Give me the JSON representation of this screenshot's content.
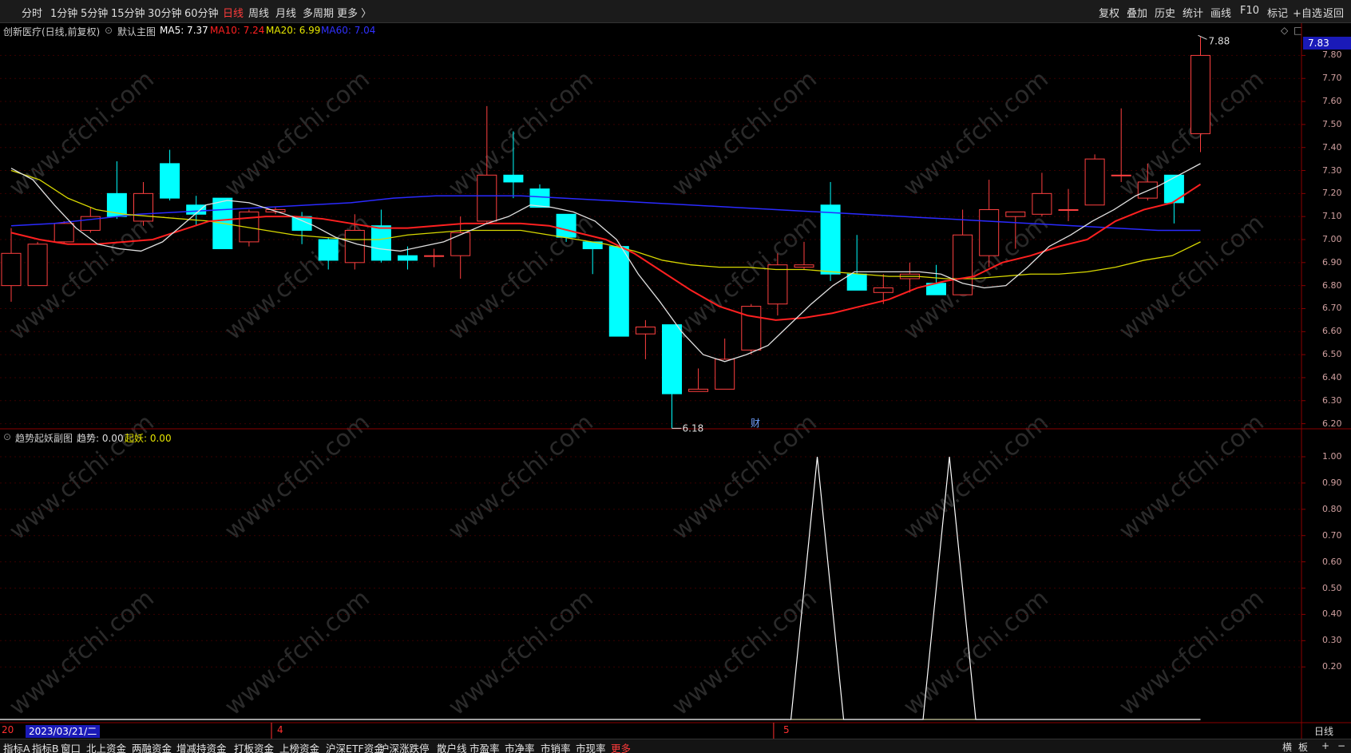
{
  "toolbar": {
    "periods": [
      "分时",
      "1分钟",
      "5分钟",
      "15分钟",
      "30分钟",
      "60分钟",
      "日线",
      "周线",
      "月线",
      "多周期",
      "更多 〉"
    ],
    "active_period": "日线",
    "right_buttons": [
      "复权",
      "叠加",
      "历史",
      "统计",
      "画线",
      "F10",
      "标记",
      "+自选",
      "返回"
    ]
  },
  "main_chart": {
    "stock_title": "创新医疗(日线,前复权)",
    "indicator_name": "默认主图",
    "ma": [
      {
        "label": "MA5: 7.37",
        "color": "#ffffff"
      },
      {
        "label": "MA10: 7.24",
        "color": "#ff2020"
      },
      {
        "label": "MA20: 6.99",
        "color": "#e6e600"
      },
      {
        "label": "MA60: 7.04",
        "color": "#3030ff"
      }
    ],
    "last_price": "7.83",
    "high_marker": "7.88",
    "low_marker": "6.18",
    "fin_marker": "财",
    "y_ticks": [
      "7.80",
      "7.70",
      "7.60",
      "7.50",
      "7.40",
      "7.30",
      "7.20",
      "7.10",
      "7.00",
      "6.90",
      "6.80",
      "6.70",
      "6.60",
      "6.50",
      "6.40",
      "6.30",
      "6.20"
    ]
  },
  "sub_chart": {
    "name": "趋势起妖副图",
    "trend_label": "趋势: 0.00",
    "qiyao_label": "起妖: 0.00",
    "y_ticks": [
      "1.00",
      "0.90",
      "0.80",
      "0.70",
      "0.60",
      "0.50",
      "0.40",
      "0.30",
      "0.20"
    ]
  },
  "chart_data": {
    "type": "candlestick",
    "candles": [
      {
        "o": 6.8,
        "h": 7.05,
        "l": 6.73,
        "c": 6.94
      },
      {
        "o": 6.8,
        "h": 6.99,
        "l": 6.8,
        "c": 6.98
      },
      {
        "o": 6.99,
        "h": 7.08,
        "l": 6.98,
        "c": 7.07
      },
      {
        "o": 7.04,
        "h": 7.14,
        "l": 7.03,
        "c": 7.1
      },
      {
        "o": 7.2,
        "h": 7.34,
        "l": 7.09,
        "c": 7.1
      },
      {
        "o": 7.08,
        "h": 7.25,
        "l": 7.06,
        "c": 7.2
      },
      {
        "o": 7.33,
        "h": 7.39,
        "l": 7.17,
        "c": 7.18
      },
      {
        "o": 7.15,
        "h": 7.19,
        "l": 7.06,
        "c": 7.11
      },
      {
        "o": 7.18,
        "h": 7.18,
        "l": 6.97,
        "c": 6.96
      },
      {
        "o": 6.99,
        "h": 7.13,
        "l": 6.97,
        "c": 7.12
      },
      {
        "o": 7.12,
        "h": 7.14,
        "l": 7.11,
        "c": 7.13
      },
      {
        "o": 7.1,
        "h": 7.12,
        "l": 6.98,
        "c": 7.04
      },
      {
        "o": 7.0,
        "h": 7.01,
        "l": 6.87,
        "c": 6.91
      },
      {
        "o": 6.9,
        "h": 7.11,
        "l": 6.87,
        "c": 7.04
      },
      {
        "o": 7.06,
        "h": 7.13,
        "l": 6.9,
        "c": 6.91
      },
      {
        "o": 6.93,
        "h": 6.97,
        "l": 6.87,
        "c": 6.91
      },
      {
        "o": 6.93,
        "h": 6.96,
        "l": 6.88,
        "c": 6.93
      },
      {
        "o": 6.93,
        "h": 7.1,
        "l": 6.83,
        "c": 7.03
      },
      {
        "o": 7.08,
        "h": 7.58,
        "l": 7.07,
        "c": 7.28
      },
      {
        "o": 7.28,
        "h": 7.47,
        "l": 7.18,
        "c": 7.25
      },
      {
        "o": 7.22,
        "h": 7.24,
        "l": 7.14,
        "c": 7.14
      },
      {
        "o": 7.11,
        "h": 7.11,
        "l": 6.99,
        "c": 7.01
      },
      {
        "o": 6.99,
        "h": 6.99,
        "l": 6.85,
        "c": 6.96
      },
      {
        "o": 6.97,
        "h": 6.97,
        "l": 6.58,
        "c": 6.58
      },
      {
        "o": 6.59,
        "h": 6.65,
        "l": 6.48,
        "c": 6.62
      },
      {
        "o": 6.63,
        "h": 6.63,
        "l": 6.18,
        "c": 6.33
      },
      {
        "o": 6.34,
        "h": 6.44,
        "l": 6.34,
        "c": 6.35
      },
      {
        "o": 6.35,
        "h": 6.57,
        "l": 6.35,
        "c": 6.48
      },
      {
        "o": 6.52,
        "h": 6.72,
        "l": 6.5,
        "c": 6.71
      },
      {
        "o": 6.72,
        "h": 6.94,
        "l": 6.67,
        "c": 6.89
      },
      {
        "o": 6.88,
        "h": 6.99,
        "l": 6.87,
        "c": 6.89
      },
      {
        "o": 7.15,
        "h": 7.25,
        "l": 6.82,
        "c": 6.85
      },
      {
        "o": 6.85,
        "h": 7.02,
        "l": 6.78,
        "c": 6.78
      },
      {
        "o": 6.77,
        "h": 6.85,
        "l": 6.72,
        "c": 6.79
      },
      {
        "o": 6.83,
        "h": 6.9,
        "l": 6.77,
        "c": 6.85
      },
      {
        "o": 6.81,
        "h": 6.89,
        "l": 6.76,
        "c": 6.76
      },
      {
        "o": 6.76,
        "h": 7.13,
        "l": 6.76,
        "c": 7.02
      },
      {
        "o": 6.93,
        "h": 7.26,
        "l": 6.88,
        "c": 7.13
      },
      {
        "o": 7.1,
        "h": 7.12,
        "l": 6.96,
        "c": 7.12
      },
      {
        "o": 7.11,
        "h": 7.29,
        "l": 7.1,
        "c": 7.2
      },
      {
        "o": 7.13,
        "h": 7.22,
        "l": 7.08,
        "c": 7.13
      },
      {
        "o": 7.15,
        "h": 7.37,
        "l": 7.15,
        "c": 7.35
      },
      {
        "o": 7.28,
        "h": 7.57,
        "l": 7.25,
        "c": 7.28
      },
      {
        "o": 7.18,
        "h": 7.33,
        "l": 7.17,
        "c": 7.25
      },
      {
        "o": 7.28,
        "h": 7.28,
        "l": 7.07,
        "c": 7.16
      },
      {
        "o": 7.46,
        "h": 7.88,
        "l": 7.38,
        "c": 7.8
      }
    ],
    "ma5": [
      7.31,
      7.26,
      7.15,
      7.05,
      6.98,
      6.96,
      6.95,
      6.99,
      7.07,
      7.15,
      7.17,
      7.16,
      7.13,
      7.1,
      7.06,
      7.01,
      6.98,
      6.96,
      6.95,
      6.97,
      6.99,
      7.03,
      7.07,
      7.1,
      7.15,
      7.14,
      7.12,
      7.08,
      7.0,
      6.85,
      6.73,
      6.6,
      6.5,
      6.47,
      6.5,
      6.54,
      6.63,
      6.72,
      6.8,
      6.86,
      6.86,
      6.86,
      6.86,
      6.85,
      6.81,
      6.79,
      6.8,
      6.88,
      6.97,
      7.02,
      7.08,
      7.13,
      7.19,
      7.23,
      7.28,
      7.33
    ],
    "ma10": [
      7.03,
      7.0,
      6.98,
      6.98,
      6.99,
      7.0,
      7.04,
      7.08,
      7.09,
      7.1,
      7.1,
      7.09,
      7.07,
      7.05,
      7.05,
      7.06,
      7.07,
      7.07,
      7.07,
      7.06,
      7.03,
      7.0,
      6.94,
      6.86,
      6.78,
      6.71,
      6.67,
      6.65,
      6.66,
      6.68,
      6.71,
      6.74,
      6.79,
      6.82,
      6.84,
      6.9,
      6.93,
      6.97,
      7.0,
      7.08,
      7.13,
      7.16,
      7.24
    ],
    "ma20": [
      7.3,
      7.26,
      7.18,
      7.13,
      7.11,
      7.1,
      7.09,
      7.08,
      7.06,
      7.04,
      7.02,
      7.01,
      7.0,
      7.0,
      7.02,
      7.03,
      7.04,
      7.04,
      7.04,
      7.02,
      7.0,
      6.98,
      6.95,
      6.91,
      6.89,
      6.88,
      6.88,
      6.87,
      6.87,
      6.86,
      6.85,
      6.84,
      6.84,
      6.83,
      6.83,
      6.84,
      6.85,
      6.85,
      6.86,
      6.88,
      6.91,
      6.93,
      6.99
    ],
    "ma60": [
      7.06,
      7.07,
      7.09,
      7.11,
      7.12,
      7.13,
      7.14,
      7.15,
      7.16,
      7.18,
      7.19,
      7.19,
      7.19,
      7.18,
      7.17,
      7.16,
      7.15,
      7.14,
      7.13,
      7.12,
      7.11,
      7.1,
      7.09,
      7.08,
      7.07,
      7.06,
      7.05,
      7.04,
      7.04
    ],
    "trend": [
      {
        "x": 30.5,
        "v": 1.0
      },
      {
        "x": 35.5,
        "v": 1.0
      }
    ],
    "x_ticks": [
      "20",
      "4",
      "5"
    ],
    "ylim_main": [
      6.15,
      7.85
    ],
    "ylim_sub": [
      0,
      1.0
    ]
  },
  "bottom": {
    "date_label": "2023/03/21/二",
    "date_prefix": "20",
    "month_4": "4",
    "month_5": "5",
    "right_label": "日线"
  },
  "tabs": [
    "指标A",
    "指标B",
    "窗口",
    "北上资金",
    "两融资金",
    "增减持资金",
    "打板资金",
    "上榜资金",
    "沪深ETF资金",
    "沪深涨跌停",
    "散户线",
    "市盈率",
    "市净率",
    "市销率",
    "市现率",
    "更多"
  ],
  "tabs_right": [
    "横",
    "板",
    "+",
    "−"
  ],
  "watermark": "www.cfchi.com"
}
